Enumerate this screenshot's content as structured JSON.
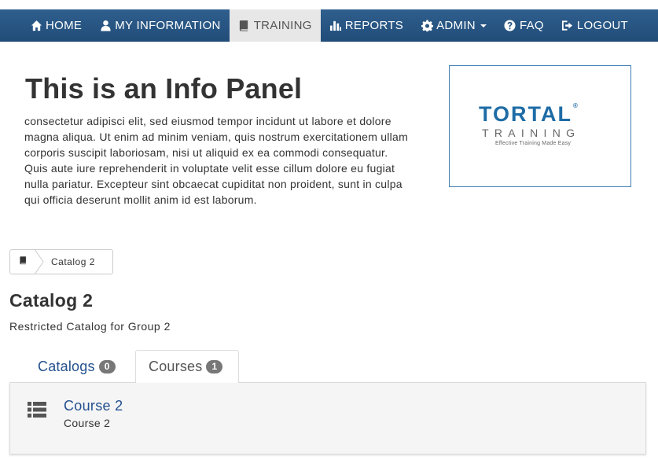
{
  "nav": {
    "items": [
      {
        "label": "HOME",
        "icon": "home-icon"
      },
      {
        "label": "MY INFORMATION",
        "icon": "user-icon"
      },
      {
        "label": "TRAINING",
        "icon": "book-icon",
        "active": true
      },
      {
        "label": "REPORTS",
        "icon": "bar-chart-icon"
      },
      {
        "label": "ADMIN",
        "icon": "gear-icon",
        "dropdown": true
      },
      {
        "label": "FAQ",
        "icon": "question-circle-icon"
      },
      {
        "label": "LOGOUT",
        "icon": "logout-icon"
      }
    ]
  },
  "info_panel": {
    "title": "This is an Info Panel",
    "body": "consectetur adipisci elit, sed eiusmod tempor incidunt ut labore et dolore magna aliqua. Ut enim ad minim veniam, quis nostrum exercitationem ullam corporis suscipit laboriosam, nisi ut aliquid ex ea commodi consequatur. Quis aute iure reprehenderit in voluptate velit esse cillum dolore eu fugiat nulla pariatur. Excepteur sint obcaecat cupiditat non proident, sunt in culpa qui officia deserunt mollit anim id est laborum."
  },
  "logo": {
    "brand": "TORTAL",
    "sub": "TRAINING",
    "tagline": "Effective Training Made Easy",
    "color": "#1e6ca6"
  },
  "breadcrumb": {
    "icon": "book-icon",
    "label": "Catalog 2"
  },
  "catalog": {
    "title": "Catalog 2",
    "description": "Restricted Catalog for Group 2"
  },
  "tabs": [
    {
      "label": "Catalogs",
      "count": "0"
    },
    {
      "label": "Courses",
      "count": "1",
      "active": true
    }
  ],
  "courses": [
    {
      "title": "Course 2",
      "subtitle": "Course 2",
      "icon": "list-icon"
    }
  ],
  "colors": {
    "navbar": "#2f5f8e",
    "link": "#23508e",
    "badge": "#777777"
  }
}
